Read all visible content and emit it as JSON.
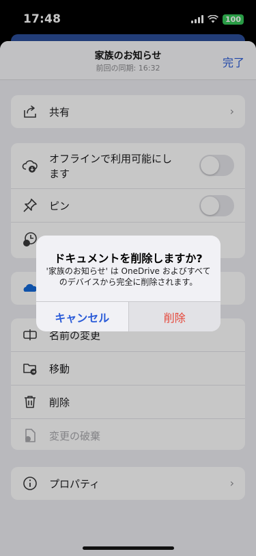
{
  "status_bar": {
    "time": "17:48",
    "battery": "100"
  },
  "nav": {
    "title": "家族のお知らせ",
    "subtitle": "前回の同期: 16:32",
    "done": "完了"
  },
  "rows": {
    "share": "共有",
    "offline_line1": "オフラインで利用可能にし",
    "offline_line2": "ます",
    "pin": "ピン",
    "rename": "名前の変更",
    "move": "移動",
    "delete": "削除",
    "discard": "変更の破棄",
    "properties": "プロパティ"
  },
  "alert": {
    "title": "ドキュメントを削除しますか?",
    "message": "'家族のお知らせ' は OneDrive およびすべてのデバイスから完全に削除されます。",
    "cancel": "キャンセル",
    "delete": "削除"
  }
}
